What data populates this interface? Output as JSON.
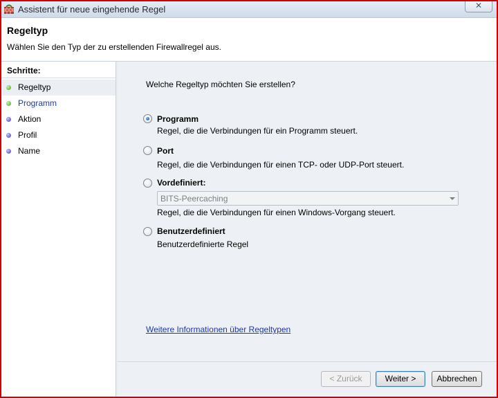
{
  "window": {
    "title": "Assistent für neue eingehende Regel",
    "close_label": "✕"
  },
  "header": {
    "title": "Regeltyp",
    "description": "Wählen Sie den Typ der zu erstellenden Firewallregel aus."
  },
  "sidebar": {
    "heading": "Schritte:",
    "steps": [
      {
        "label": "Regeltyp",
        "status": "done"
      },
      {
        "label": "Programm",
        "status": "current"
      },
      {
        "label": "Aktion",
        "status": "pending"
      },
      {
        "label": "Profil",
        "status": "pending"
      },
      {
        "label": "Name",
        "status": "pending"
      }
    ]
  },
  "main": {
    "question": "Welche Regeltyp möchten Sie erstellen?",
    "options": [
      {
        "title": "Programm",
        "description": "Regel, die die Verbindungen für ein Programm steuert.",
        "checked": true
      },
      {
        "title": "Port",
        "description": "Regel, die die Verbindungen für einen TCP- oder UDP-Port steuert.",
        "checked": false
      },
      {
        "title": "Vordefiniert:",
        "description": "Regel, die die Verbindungen für einen Windows-Vorgang steuert.",
        "checked": false
      },
      {
        "title": "Benutzerdefiniert",
        "description": "Benutzerdefinierte Regel",
        "checked": false
      }
    ],
    "predefined_select_value": "BITS-Peercaching",
    "info_link": "Weitere Informationen über Regeltypen"
  },
  "buttons": {
    "back": "< Zurück",
    "next": "Weiter >",
    "cancel": "Abbrechen"
  },
  "colors": {
    "step_done": "#45a418",
    "step_pending": "#3c35b8",
    "link": "#1a3aa8"
  }
}
